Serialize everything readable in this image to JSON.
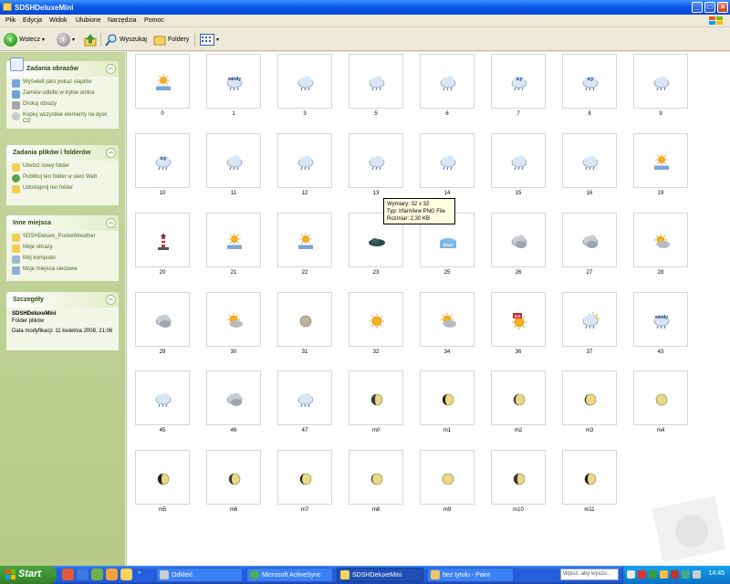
{
  "window": {
    "title": "SDSHDeluxeMini"
  },
  "menu": [
    "Plik",
    "Edycja",
    "Widok",
    "Ulubione",
    "Narzędzia",
    "Pomoc"
  ],
  "toolbar": {
    "back_label": "Wstecz",
    "search_label": "Wyszukaj",
    "folders_label": "Foldery"
  },
  "sidebar": {
    "panels": [
      {
        "title": "Zadania obrazów",
        "items": [
          {
            "label": "Wyświetl jako pokaz slajdów",
            "icon": "slideshow-icon"
          },
          {
            "label": "Zamów odbitki w trybie online",
            "icon": "order-prints-icon"
          },
          {
            "label": "Drukuj obrazy",
            "icon": "printer-icon"
          },
          {
            "label": "Kopiuj wszystkie elementy na dysk CD",
            "icon": "cd-copy-icon"
          }
        ]
      },
      {
        "title": "Zadania plików i folderów",
        "items": [
          {
            "label": "Utwórz nowy folder",
            "icon": "new-folder-icon"
          },
          {
            "label": "Publikuj ten folder w sieci Web",
            "icon": "publish-web-icon"
          },
          {
            "label": "Udostępnij ten folder",
            "icon": "share-folder-icon"
          }
        ]
      },
      {
        "title": "Inne miejsca",
        "items": [
          {
            "label": "SDSHDeluxe_PocketWeather",
            "icon": "folder-icon"
          },
          {
            "label": "Moje obrazy",
            "icon": "my-pictures-icon"
          },
          {
            "label": "Mój komputer",
            "icon": "my-computer-icon"
          },
          {
            "label": "Moje miejsca sieciowe",
            "icon": "network-places-icon"
          }
        ]
      },
      {
        "title": "Szczegóły",
        "detail_name": "SDSHDeluxeMini",
        "detail_type": "Folder plików",
        "detail_date": "Data modyfikacji: 11 kwietnia 2008, 21:06"
      }
    ]
  },
  "files": [
    {
      "name": "0",
      "icon": "sun-snow-icon"
    },
    {
      "name": "1",
      "icon": "windy-cloud-icon",
      "text": "windy"
    },
    {
      "name": "3",
      "icon": "cloud-rain-icon"
    },
    {
      "name": "5",
      "icon": "cloud-rain-icon"
    },
    {
      "name": "6",
      "icon": "cloud-rain-icon"
    },
    {
      "name": "7",
      "icon": "icy-cloud-icon",
      "text": "icy"
    },
    {
      "name": "8",
      "icon": "icy-cloud-icon",
      "text": "icy"
    },
    {
      "name": "9",
      "icon": "cloud-rain-icon"
    },
    {
      "name": "10",
      "icon": "icy-cloud-icon",
      "text": "icy"
    },
    {
      "name": "11",
      "icon": "cloud-rain-icon"
    },
    {
      "name": "12",
      "icon": "cloud-rain-icon"
    },
    {
      "name": "13",
      "icon": "cloud-rain-icon"
    },
    {
      "name": "14",
      "icon": "cloud-rain-icon"
    },
    {
      "name": "15",
      "icon": "cloud-rain-icon"
    },
    {
      "name": "16",
      "icon": "cloud-rain-icon"
    },
    {
      "name": "19",
      "icon": "sun-snow-icon"
    },
    {
      "name": "20",
      "icon": "lighthouse-icon"
    },
    {
      "name": "21",
      "icon": "sun-snow-icon"
    },
    {
      "name": "22",
      "icon": "sun-snow-icon"
    },
    {
      "name": "23",
      "icon": "dark-cloud-icon"
    },
    {
      "name": "25",
      "icon": "frost-icon",
      "text": "frost"
    },
    {
      "name": "26",
      "icon": "cloudy-icon"
    },
    {
      "name": "27",
      "icon": "cloudy-icon"
    },
    {
      "name": "28",
      "icon": "partly-sunny-icon"
    },
    {
      "name": "29",
      "icon": "cloudy-icon"
    },
    {
      "name": "30",
      "icon": "partly-sunny-icon"
    },
    {
      "name": "31",
      "icon": "moon-icon"
    },
    {
      "name": "32",
      "icon": "sun-icon"
    },
    {
      "name": "34",
      "icon": "partly-sunny-icon"
    },
    {
      "name": "36",
      "icon": "hot-sun-icon",
      "text": "hot"
    },
    {
      "name": "37",
      "icon": "sun-rain-icon"
    },
    {
      "name": "43",
      "icon": "windy-cloud-icon",
      "text": "windy"
    },
    {
      "name": "45",
      "icon": "cloud-rain-icon"
    },
    {
      "name": "46",
      "icon": "cloudy-icon"
    },
    {
      "name": "47",
      "icon": "cloud-rain-icon"
    },
    {
      "name": "m0",
      "icon": "moon-phase-icon"
    },
    {
      "name": "m1",
      "icon": "moon-phase-icon"
    },
    {
      "name": "m2",
      "icon": "moon-phase-icon"
    },
    {
      "name": "m3",
      "icon": "moon-phase-icon"
    },
    {
      "name": "m4",
      "icon": "moon-phase-icon"
    },
    {
      "name": "m5",
      "icon": "moon-phase-icon"
    },
    {
      "name": "m6",
      "icon": "moon-phase-icon"
    },
    {
      "name": "m7",
      "icon": "moon-phase-icon"
    },
    {
      "name": "m8",
      "icon": "moon-phase-icon"
    },
    {
      "name": "m9",
      "icon": "moon-phase-icon"
    },
    {
      "name": "m10",
      "icon": "moon-phase-icon"
    },
    {
      "name": "m11",
      "icon": "moon-phase-icon"
    }
  ],
  "tooltip": {
    "line1": "Wymiary: 32 x 32",
    "line2": "Typ: IrfanView PNG File",
    "line3": "Rozmiar: 2,30 KB"
  },
  "taskbar": {
    "start_label": "Start",
    "buttons": [
      {
        "label": "Odkleić",
        "icon": "camera-icon",
        "active": false
      },
      {
        "label": "Microsoft ActiveSync",
        "icon": "activesync-icon",
        "active": false
      },
      {
        "label": "SDSHDeluxeMini",
        "icon": "folder-icon",
        "active": true
      },
      {
        "label": "bez tytułu - Paint",
        "icon": "paint-icon",
        "active": false
      }
    ],
    "search_placeholder": "Wpisz, aby wyszu...",
    "clock": "14:45"
  }
}
